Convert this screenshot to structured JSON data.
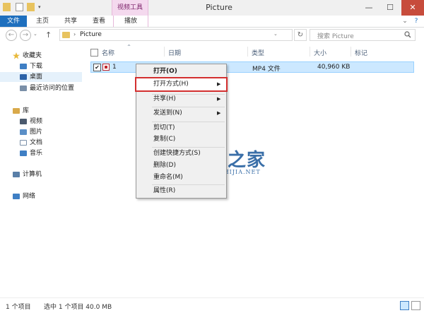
{
  "window": {
    "title": "Picture",
    "context_group": "视频工具",
    "minimize": "—",
    "maximize": "☐",
    "close": "✕"
  },
  "ribbon": {
    "tabs": [
      "文件",
      "主页",
      "共享",
      "查看",
      "播放"
    ],
    "expand_icon": "chevron-down-icon",
    "help_icon": "help-icon",
    "expand": "⌄",
    "help": "?"
  },
  "address": {
    "back": "←",
    "forward": "→",
    "recent": "⌄",
    "up": "↑",
    "arrow": "›",
    "path": "Picture",
    "dropdown": "⌄",
    "refresh": "↻",
    "search_placeholder": "搜索 Picture"
  },
  "nav": {
    "favorites": "收藏夹",
    "downloads": "下载",
    "desktop": "桌面",
    "recent": "最近访问的位置",
    "libraries": "库",
    "videos": "视频",
    "pictures": "图片",
    "documents": "文档",
    "music": "音乐",
    "computer": "计算机",
    "network": "网络"
  },
  "columns": {
    "name": "名称",
    "date": "日期",
    "type": "类型",
    "size": "大小",
    "tags": "标记"
  },
  "files": [
    {
      "name": "1",
      "type": "MP4 文件",
      "size": "40,960 KB",
      "checked": "✔"
    }
  ],
  "context_menu": {
    "open": "打开(O)",
    "open_with": "打开方式(H)",
    "share": "共享(H)",
    "send_to": "发送到(N)",
    "cut": "剪切(T)",
    "copy": "复制(C)",
    "create_shortcut": "创建快捷方式(S)",
    "delete": "删除(D)",
    "rename": "重命名(M)",
    "properties": "属性(R)",
    "submenu_arrow": "▶"
  },
  "watermark": {
    "title": "系统之家",
    "subtitle": "XITONGZHIJIA.NET"
  },
  "status": {
    "count": "1 个项目",
    "selected": "选中 1 个项目  40.0 MB"
  },
  "colors": {
    "accent": "#1e6fbe",
    "selection": "#cce8ff",
    "highlight_box": "#d32f2f",
    "close_button": "#c74c3c"
  }
}
